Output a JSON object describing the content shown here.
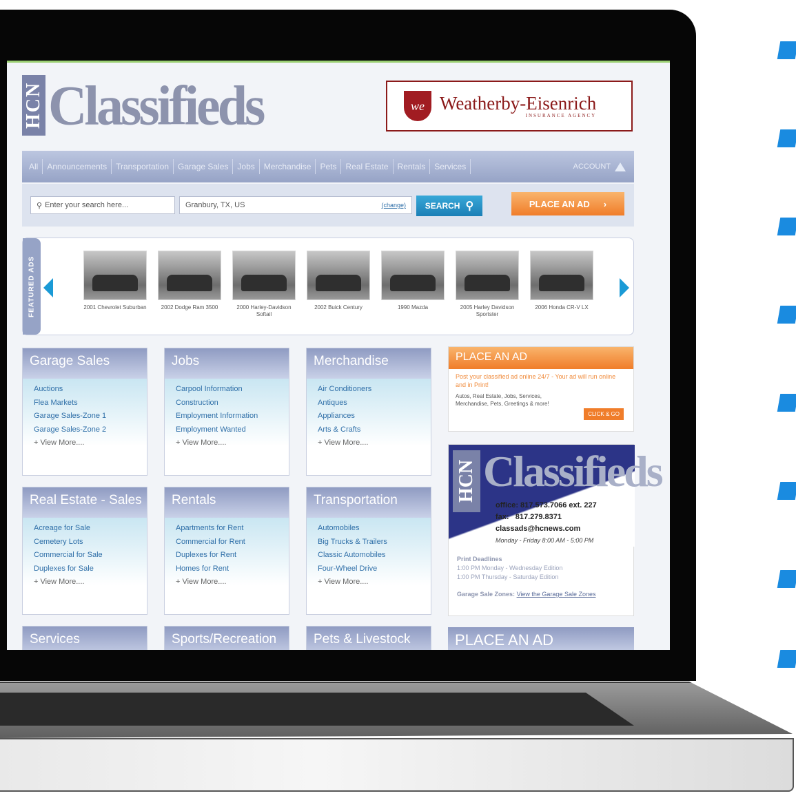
{
  "header": {
    "logo_hcn": "HCN",
    "logo_text": "Classifieds",
    "ad_monogram": "we",
    "ad_name": "Weatherby-Eisenrich",
    "ad_sub": "INSURANCE AGENCY"
  },
  "nav": {
    "items": [
      "All",
      "Announcements",
      "Transportation",
      "Garage Sales",
      "Jobs",
      "Merchandise",
      "Pets",
      "Real Estate",
      "Rentals",
      "Services"
    ],
    "account": "ACCOUNT"
  },
  "search": {
    "placeholder": "Enter your search here...",
    "location": "Granbury, TX, US",
    "change_link": "(change)",
    "search_label": "SEARCH",
    "place_ad_label": "PLACE AN AD"
  },
  "featured": {
    "label": "FEATURED ADS",
    "items": [
      {
        "caption": "2001 Chevrolet Suburban"
      },
      {
        "caption": "2002 Dodge Ram 3500"
      },
      {
        "caption": "2000 Harley-Davidson Softail"
      },
      {
        "caption": "2002 Buick Century"
      },
      {
        "caption": "1990 Mazda"
      },
      {
        "caption": "2005 Harley Davidson Sportster"
      },
      {
        "caption": "2006 Honda CR-V LX"
      }
    ]
  },
  "categories": [
    {
      "title": "Garage Sales",
      "links": [
        "Auctions",
        "Flea Markets",
        "Garage Sales-Zone 1",
        "Garage Sales-Zone 2"
      ],
      "more": "+ View More...."
    },
    {
      "title": "Jobs",
      "links": [
        "Carpool Information",
        "Construction",
        "Employment Information",
        "Employment Wanted"
      ],
      "more": "+ View More...."
    },
    {
      "title": "Merchandise",
      "links": [
        "Air Conditioners",
        "Antiques",
        "Appliances",
        "Arts & Crafts"
      ],
      "more": "+ View More...."
    },
    {
      "title": "Real Estate - Sales",
      "links": [
        "Acreage for Sale",
        "Cemetery Lots",
        "Commercial for Sale",
        "Duplexes for Sale"
      ],
      "more": "+ View More...."
    },
    {
      "title": "Rentals",
      "links": [
        "Apartments for Rent",
        "Commercial for Rent",
        "Duplexes for Rent",
        "Homes for Rent"
      ],
      "more": "+ View More...."
    },
    {
      "title": "Transportation",
      "links": [
        "Automobiles",
        "Big Trucks & Trailers",
        "Classic Automobiles",
        "Four-Wheel Drive"
      ],
      "more": "+ View More...."
    },
    {
      "title": "Services"
    },
    {
      "title": "Sports/Recreation"
    },
    {
      "title": "Pets & Livestock"
    }
  ],
  "place_box": {
    "title": "PLACE AN AD",
    "text": "Post your classified ad online 24/7 - Your ad will run online and in Print!",
    "small": "Autos, Real Estate, Jobs, Services, Merchandise, Pets, Greetings & more!",
    "button": "CLICK & GO"
  },
  "contact": {
    "logo_hcn": "HCN",
    "logo_text": "Classifieds",
    "office": "office: 817.573.7066 ext. 227",
    "fax": "fax:   817.279.8371",
    "email": "classads@hcnews.com",
    "hours": "Monday - Friday 8:00 AM - 5:00 PM",
    "deadlines_title": "Print Deadlines",
    "deadline_1": "1:00 PM Monday - Wednesday Edition",
    "deadline_2": "1:00 PM Thursday - Saturday Edition",
    "zones_label": "Garage Sale Zones:",
    "zones_link": "View the Garage Sale Zones"
  },
  "place_bottom": "PLACE AN AD",
  "colors": {
    "nav": "#96a3c6",
    "accent_orange": "#f07d2a",
    "search_blue": "#1b7fb6",
    "link_blue": "#2f6fa8",
    "deco_blue": "#1a8be0"
  }
}
